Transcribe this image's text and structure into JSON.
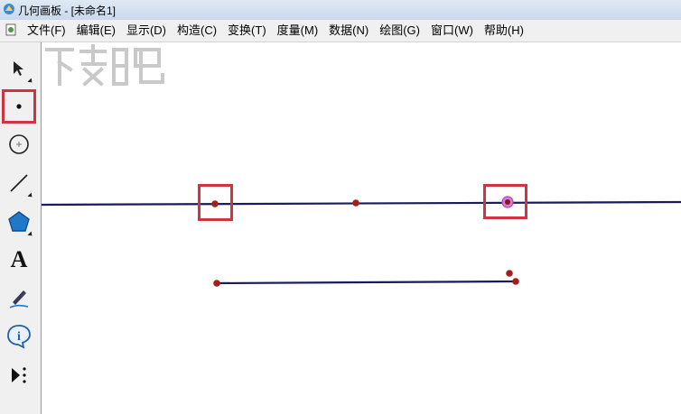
{
  "window": {
    "title": "几何画板 - [未命名1]"
  },
  "menu": [
    {
      "label": "文件(F)"
    },
    {
      "label": "编辑(E)"
    },
    {
      "label": "显示(D)"
    },
    {
      "label": "构造(C)"
    },
    {
      "label": "变换(T)"
    },
    {
      "label": "度量(M)"
    },
    {
      "label": "数据(N)"
    },
    {
      "label": "绘图(G)"
    },
    {
      "label": "窗口(W)"
    },
    {
      "label": "帮助(H)"
    }
  ],
  "toolbox": {
    "tools": [
      {
        "name": "selection-arrow-icon",
        "selected": false
      },
      {
        "name": "point-tool-icon",
        "selected": true
      },
      {
        "name": "compass-tool-icon",
        "selected": false
      },
      {
        "name": "straightedge-tool-icon",
        "selected": false
      },
      {
        "name": "polygon-tool-icon",
        "selected": false
      },
      {
        "name": "text-tool-icon",
        "selected": false,
        "glyph": "A"
      },
      {
        "name": "marker-tool-icon",
        "selected": false
      },
      {
        "name": "information-tool-icon",
        "selected": false
      },
      {
        "name": "custom-tool-icon",
        "selected": false
      }
    ]
  },
  "colors": {
    "line": "#1a1a5e",
    "point": "#a51d1d",
    "selected_point_ring": "#c03cc0",
    "highlight": "#d0343f"
  }
}
